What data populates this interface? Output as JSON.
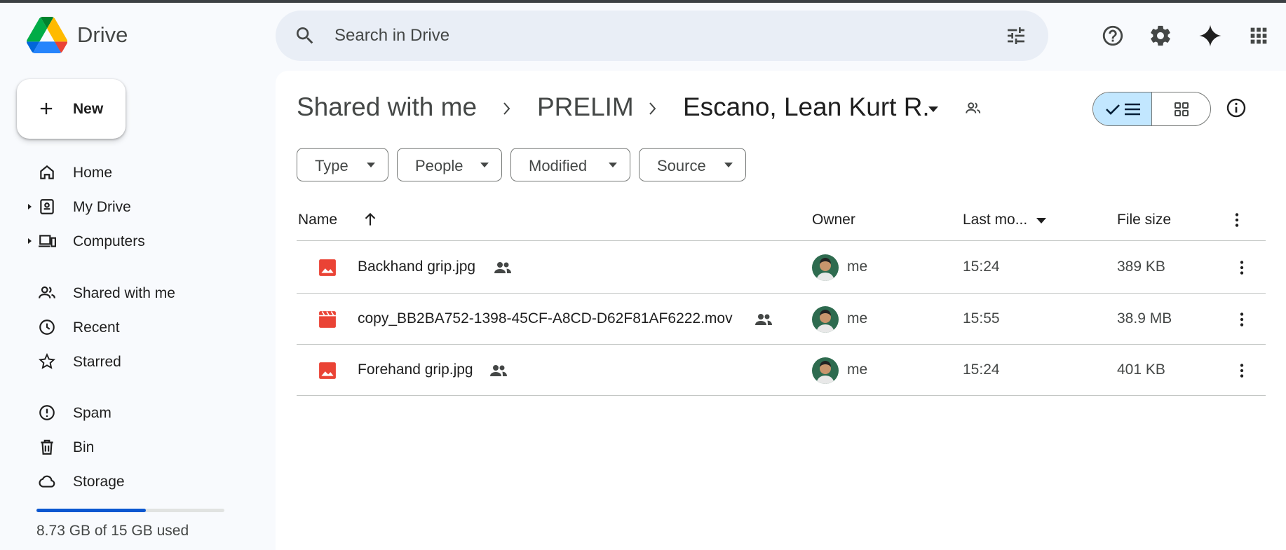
{
  "app": {
    "name": "Drive"
  },
  "search": {
    "placeholder": "Search in Drive"
  },
  "header_icons": [
    "help-icon",
    "settings-icon",
    "gemini-sparkle-icon",
    "apps-grid-icon"
  ],
  "sidebar": {
    "new_label": "New",
    "items": [
      {
        "label": "Home",
        "icon": "home-icon"
      },
      {
        "label": "My Drive",
        "icon": "my-drive-icon"
      },
      {
        "label": "Computers",
        "icon": "computers-icon"
      },
      {
        "label": "Shared with me",
        "icon": "shared-people-icon"
      },
      {
        "label": "Recent",
        "icon": "clock-icon"
      },
      {
        "label": "Starred",
        "icon": "star-icon"
      },
      {
        "label": "Spam",
        "icon": "spam-icon"
      },
      {
        "label": "Bin",
        "icon": "trash-icon"
      },
      {
        "label": "Storage",
        "icon": "cloud-icon"
      }
    ],
    "storage_text": "8.73 GB of 15 GB used",
    "storage_used_fraction": 0.582
  },
  "breadcrumb": {
    "items": [
      "Shared with me",
      "PRELIM",
      "Escano, Lean Kurt R."
    ]
  },
  "filters": [
    "Type",
    "People",
    "Modified",
    "Source"
  ],
  "table": {
    "columns": {
      "name": "Name",
      "owner": "Owner",
      "modified": "Last mo...",
      "size": "File size"
    },
    "rows": [
      {
        "name": "Backhand grip.jpg",
        "type": "image",
        "owner": "me",
        "modified": "15:24",
        "size": "389 KB"
      },
      {
        "name": "copy_BB2BA752-1398-45CF-A8CD-D62F81AF6222.mov",
        "type": "video",
        "owner": "me",
        "modified": "15:55",
        "size": "38.9 MB"
      },
      {
        "name": "Forehand grip.jpg",
        "type": "image",
        "owner": "me",
        "modified": "15:24",
        "size": "401 KB"
      }
    ]
  },
  "colors": {
    "accent": "#0b57d0",
    "selected_toggle": "#c2e7ff",
    "file_icon_red": "#ea4335",
    "background": "#f8fafd"
  }
}
